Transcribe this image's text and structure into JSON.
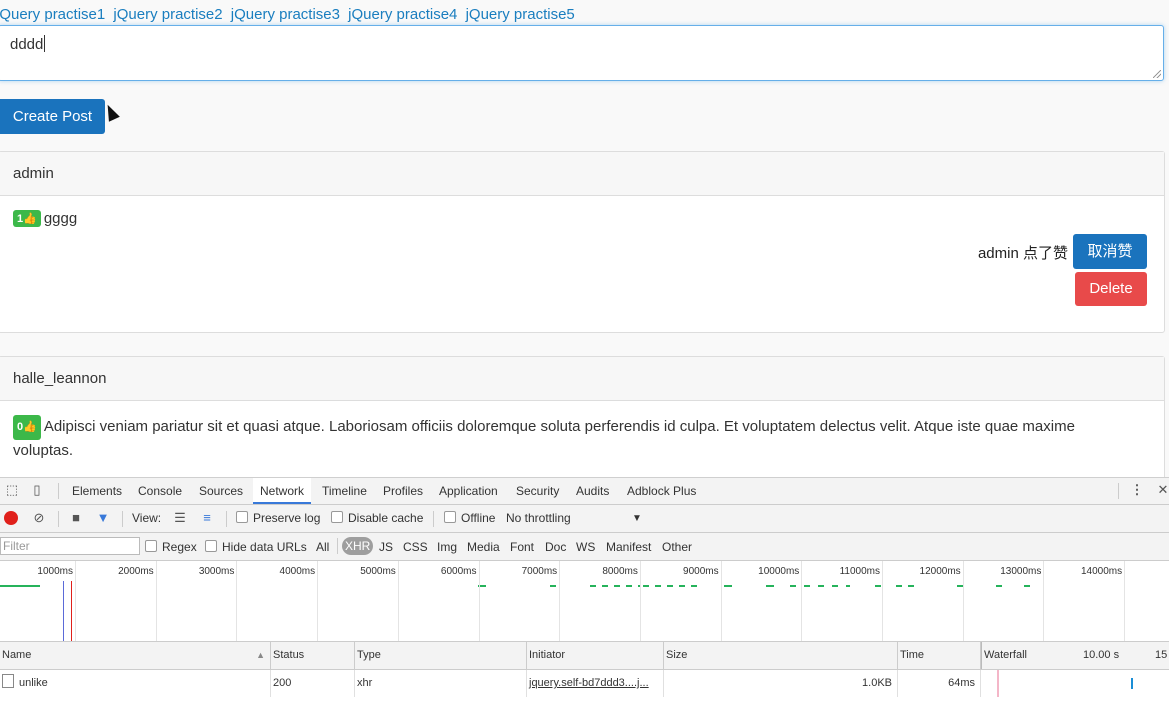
{
  "nav": {
    "links": [
      "jQuery practise1",
      "jQuery practise2",
      "jQuery practise3",
      "jQuery practise4",
      "jQuery practise5"
    ]
  },
  "composer": {
    "value": "dddd",
    "create_label": "Create Post"
  },
  "posts": [
    {
      "author": "admin",
      "likes": "1",
      "body": "gggg",
      "liked_by_text": "admin 点了赞",
      "unlike_label": "取消赞",
      "delete_label": "Delete"
    },
    {
      "author": "halle_leannon",
      "likes": "0",
      "body": "Adipisci veniam pariatur sit et quasi atque. Laboriosam officiis doloremque soluta perferendis id culpa. Et voluptatem delectus velit. Atque iste quae maxime voluptas."
    }
  ],
  "devtools": {
    "tabs": [
      "Elements",
      "Console",
      "Sources",
      "Network",
      "Timeline",
      "Profiles",
      "Application",
      "Security",
      "Audits",
      "Adblock Plus"
    ],
    "active_tab": "Network",
    "toolbar": {
      "view_label": "View:",
      "preserve_log": "Preserve log",
      "disable_cache": "Disable cache",
      "offline": "Offline",
      "throttling": "No throttling"
    },
    "filter": {
      "placeholder": "Filter",
      "regex": "Regex",
      "hide_data_urls": "Hide data URLs",
      "types": [
        "All",
        "XHR",
        "JS",
        "CSS",
        "Img",
        "Media",
        "Font",
        "Doc",
        "WS",
        "Manifest",
        "Other"
      ],
      "active_type": "XHR"
    },
    "timeline_ticks": [
      "1000ms",
      "2000ms",
      "3000ms",
      "4000ms",
      "5000ms",
      "6000ms",
      "7000ms",
      "8000ms",
      "9000ms",
      "10000ms",
      "11000ms",
      "12000ms",
      "13000ms",
      "14000ms",
      "15"
    ],
    "columns": [
      "Name",
      "Status",
      "Type",
      "Initiator",
      "Size",
      "Time",
      "Waterfall"
    ],
    "waterfall_scale": [
      "10.00 s",
      "15"
    ],
    "rows": [
      {
        "name": "unlike",
        "status": "200",
        "type": "xhr",
        "initiator": "jquery.self-bd7ddd3....j...",
        "size": "1.0KB",
        "time": "64ms"
      }
    ],
    "colors": {
      "accent": "#3879d9",
      "record": "#e0201b",
      "success": "#26b35b"
    }
  }
}
